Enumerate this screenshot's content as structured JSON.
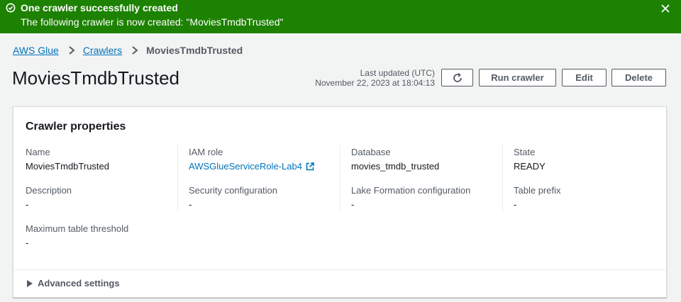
{
  "flash": {
    "title": "One crawler successfully created",
    "message": "The following crawler is now created: \"MoviesTmdbTrusted\"",
    "icons": {
      "status": "check-circle-icon",
      "close": "close-icon"
    },
    "color": "#1d8102"
  },
  "breadcrumb": {
    "items": [
      "AWS Glue",
      "Crawlers"
    ],
    "current": "MoviesTmdbTrusted"
  },
  "header": {
    "title": "MoviesTmdbTrusted",
    "last_updated_label": "Last updated (UTC)",
    "last_updated_value": "November 22, 2023 at 18:04:13",
    "buttons": {
      "refresh_icon": "refresh-icon",
      "run": "Run crawler",
      "edit": "Edit",
      "delete": "Delete"
    }
  },
  "properties": {
    "title": "Crawler properties",
    "fields": {
      "name": {
        "label": "Name",
        "value": "MoviesTmdbTrusted"
      },
      "iam_role": {
        "label": "IAM role",
        "value": "AWSGlueServiceRole-Lab4"
      },
      "database": {
        "label": "Database",
        "value": "movies_tmdb_trusted"
      },
      "state": {
        "label": "State",
        "value": "READY"
      },
      "description": {
        "label": "Description",
        "value": "-"
      },
      "security": {
        "label": "Security configuration",
        "value": "-"
      },
      "lake_formation": {
        "label": "Lake Formation configuration",
        "value": "-"
      },
      "table_prefix": {
        "label": "Table prefix",
        "value": "-"
      },
      "max_table": {
        "label": "Maximum table threshold",
        "value": "-"
      }
    },
    "advanced_settings": "Advanced settings"
  },
  "colors": {
    "link": "#0073bb",
    "success": "#1d8102",
    "text": "#16191f",
    "muted": "#545b64"
  }
}
